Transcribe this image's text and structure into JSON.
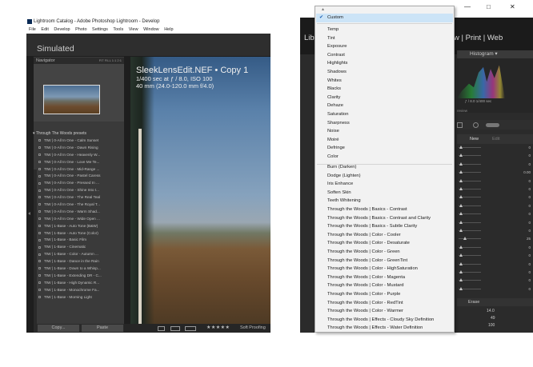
{
  "left_window": {
    "title": "Lightroom Catalog - Adobe Photoshop Lightroom - Develop",
    "menu": [
      "File",
      "Edit",
      "Develop",
      "Photo",
      "Settings",
      "Tools",
      "View",
      "Window",
      "Help"
    ],
    "identity": "Simulated",
    "navigator": {
      "title": "Navigator",
      "zoom_options": "FIT  FILL  1:1  2:1"
    },
    "preset_folder": "Through The Woods presets",
    "presets": [
      "TtW | 0-All In One - Calm Sunset",
      "TtW | 0-All In One - Dawn Rising",
      "TtW | 0-All In One - Heavenly W...",
      "TtW | 0-All In One - Love Me Te...",
      "TtW | 0-All In One - Mid-Range ...",
      "TtW | 0-All In One - Pastel Caress",
      "TtW | 0-All In One - Pressed In ...",
      "TtW | 0-All In One - Shine Into t...",
      "TtW | 0-All In One - The Real Teal",
      "TtW | 0-All In One - The Royal T...",
      "TtW | 0-All In One - Warm Shad...",
      "TtW | 0-All In One - Wide Open ...",
      "TtW | 1-Base - Auto Tone (B&W)",
      "TtW | 1-Base - Auto Tone (Color)",
      "TtW | 1-Base - Basic Film",
      "TtW | 1-Base - Cinematic",
      "TtW | 1-Base - Color - Autumn ...",
      "TtW | 1-Base - Dance in the Rain",
      "TtW | 1-Base - Down to a Whisp...",
      "TtW | 1-Base - Extending DR - C...",
      "TtW | 1-Base - High Dynamic R...",
      "TtW | 1-Base - Monochrome Fa...",
      "TtW | 1-Base - Morning Light"
    ],
    "copy_button": "Copy...",
    "paste_button": "Paste",
    "photo_name": "SleekLensEdit.NEF  •  Copy 1",
    "photo_meta_1": "1/400 sec at ƒ / 8.0, ISO 100",
    "photo_meta_2": "40 mm (24.0-120.0 mm f/4.0)",
    "stars": "★★★★★",
    "soft_proofing": "Soft Proofing"
  },
  "right_window": {
    "modules": "Library  |  Develop  |  Map  |  Book  |  Slideshow  |  Print  |  Web",
    "modules_visible": "Lib",
    "modules_visible_right": "w  |  Print  |  Web",
    "histogram_title": "Histogram",
    "histogram_meta": "ƒ / 8.0     1/400 sec",
    "histogram_meta2": "review",
    "new_label": "New",
    "edit_label": "Edit",
    "slider_values": [
      "0",
      "0",
      "0",
      "0.00",
      "0",
      "0",
      "0",
      "0",
      "0",
      "0",
      "0",
      "25",
      "0",
      "0",
      "0",
      "0",
      "0",
      "0"
    ],
    "erase_label": "Erase",
    "tail_values": [
      "14.0",
      "49",
      "100"
    ],
    "window_controls": [
      "—",
      "□",
      "✕"
    ]
  },
  "dropdown": {
    "selected": "Custom",
    "group1": [
      "Temp",
      "Tint",
      "Exposure",
      "Contrast",
      "Highlights",
      "Shadows",
      "Whites",
      "Blacks",
      "Clarity",
      "Dehaze",
      "Saturation",
      "Sharpness",
      "Noise",
      "Moiré",
      "Defringe",
      "Color"
    ],
    "group2": [
      "Burn (Darken)",
      "Dodge (Lighten)",
      "Iris Enhance",
      "Soften Skin",
      "Teeth Whitening",
      "Through the Woods | Basics - Contrast",
      "Through the Woods | Basics - Contrast and Clarity",
      "Through the Woods | Basics - Subtle Clarity",
      "Through the Woods | Color - Cooler",
      "Through the Woods | Color - Desaturate",
      "Through the Woods | Color - Green",
      "Through the Woods | Color - GreenTint",
      "Through the Woods | Color - HighSaturation",
      "Through the Woods | Color - Magenta",
      "Through the Woods | Color - Mustard",
      "Through the Woods | Color - Purple",
      "Through the Woods | Color - RedTint",
      "Through the Woods | Color - Warmer",
      "Through the Woods | Effects - Cloudy Sky Definition",
      "Through the Woods | Effects - Water Definition"
    ]
  }
}
